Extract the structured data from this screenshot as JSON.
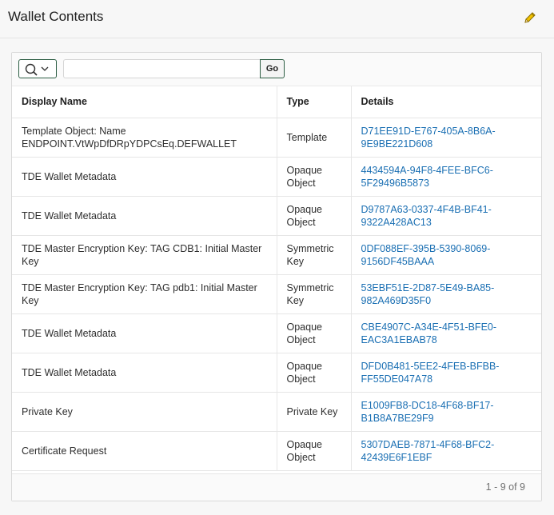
{
  "header": {
    "title": "Wallet Contents",
    "edit_icon": "pencil-icon"
  },
  "toolbar": {
    "search_icon": "search-icon",
    "menu_icon": "chevron-down-icon",
    "search_value": "",
    "go_label": "Go"
  },
  "table": {
    "columns": [
      "Display Name",
      "Type",
      "Details"
    ],
    "rows": [
      {
        "name": "Template Object: Name ENDPOINT.VtWpDfDRpYDPCsEq.DEFWALLET",
        "type": "Template",
        "details": "D71EE91D-E767-405A-8B6A-9E9BE221D608"
      },
      {
        "name": "TDE Wallet Metadata",
        "type": "Opaque Object",
        "details": "4434594A-94F8-4FEE-BFC6-5F29496B5873"
      },
      {
        "name": "TDE Wallet Metadata",
        "type": "Opaque Object",
        "details": "D9787A63-0337-4F4B-BF41-9322A428AC13"
      },
      {
        "name": "TDE Master Encryption Key: TAG CDB1: Initial Master Key",
        "type": "Symmetric Key",
        "details": "0DF088EF-395B-5390-8069-9156DF45BAAA"
      },
      {
        "name": "TDE Master Encryption Key: TAG pdb1: Initial Master Key",
        "type": "Symmetric Key",
        "details": "53EBF51E-2D87-5E49-BA85-982A469D35F0"
      },
      {
        "name": "TDE Wallet Metadata",
        "type": "Opaque Object",
        "details": "CBE4907C-A34E-4F51-BFE0-EAC3A1EBAB78"
      },
      {
        "name": "TDE Wallet Metadata",
        "type": "Opaque Object",
        "details": "DFD0B481-5EE2-4FEB-BFBB-FF55DE047A78"
      },
      {
        "name": "Private Key",
        "type": "Private Key",
        "details": "E1009FB8-DC18-4F68-BF17-B1B8A7BE29F9"
      },
      {
        "name": "Certificate Request",
        "type": "Opaque Object",
        "details": "5307DAEB-7871-4F68-BFC2-42439E6F1EBF"
      }
    ]
  },
  "footer": {
    "pagination": "1 - 9 of 9"
  },
  "colors": {
    "link": "#1a6fb3",
    "button_border": "#2d5e44",
    "edit_icon": "#e0b500"
  }
}
